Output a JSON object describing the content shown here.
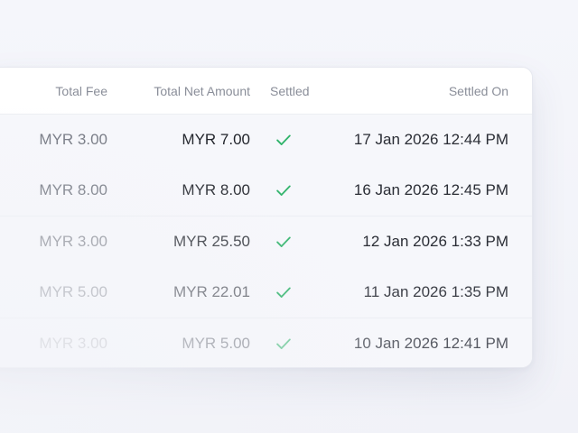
{
  "table": {
    "columns": {
      "total_fee": "Total Fee",
      "total_net_amount": "Total Net Amount",
      "settled": "Settled",
      "settled_on": "Settled On"
    },
    "rows": [
      {
        "total_fee": "MYR 3.00",
        "total_net_amount": "MYR 7.00",
        "settled": true,
        "settled_on": "17 Jan 2026 12:44 PM"
      },
      {
        "total_fee": "MYR 8.00",
        "total_net_amount": "MYR 8.00",
        "settled": true,
        "settled_on": "16 Jan 2026 12:45 PM"
      },
      {
        "total_fee": "MYR 3.00",
        "total_net_amount": "MYR 25.50",
        "settled": true,
        "settled_on": "12 Jan 2026 1:33 PM"
      },
      {
        "total_fee": "MYR 5.00",
        "total_net_amount": "MYR 22.01",
        "settled": true,
        "settled_on": "11 Jan 2026 1:35 PM"
      },
      {
        "total_fee": "MYR 3.00",
        "total_net_amount": "MYR 5.00",
        "settled": true,
        "settled_on": "10 Jan 2026 12:41 PM"
      }
    ]
  },
  "colors": {
    "check": "#2fb36a",
    "header_text": "#8a8e99",
    "row_background": "#f6f7fb"
  },
  "icons": {
    "settled": "checkmark-icon"
  }
}
